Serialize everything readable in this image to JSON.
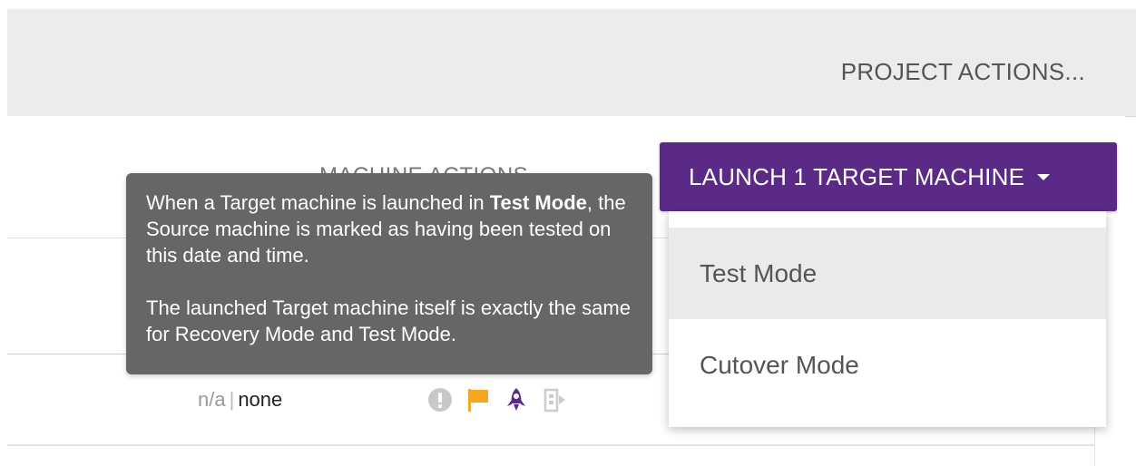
{
  "header": {
    "project_actions_label": "PROJECT ACTIONS..."
  },
  "machine": {
    "actions_label": "MACHINE ACTIONS",
    "launch_button_label": "LAUNCH 1 TARGET MACHINE"
  },
  "dropdown": {
    "items": [
      {
        "label": "Test Mode"
      },
      {
        "label": "Cutover Mode"
      }
    ]
  },
  "tooltip": {
    "p1_before": "When a Target machine is launched in ",
    "p1_bold": "Test Mode",
    "p1_after": ", the Source machine is marked as having been tested on this date and time.",
    "p2": "The launched Target machine itself is exactly the same for Recovery Mode and Test Mode."
  },
  "row": {
    "status_na": "n/a",
    "status_separator": "|",
    "status_value": "none",
    "icons": [
      "alert-icon",
      "flag-icon",
      "rocket-icon",
      "door-exit-icon"
    ]
  },
  "colors": {
    "launch_button_bg": "#5b2a86",
    "tooltip_bg": "#666666",
    "flag": "#f5a623",
    "rocket": "#5b2a86",
    "alert_icon": "#c8c8c8"
  }
}
